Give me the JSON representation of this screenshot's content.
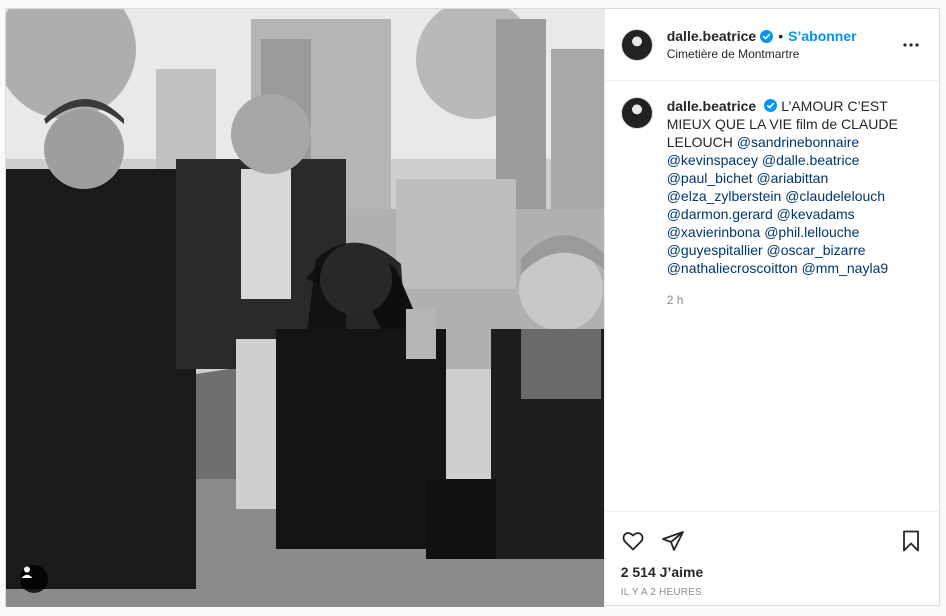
{
  "header": {
    "username": "dalle.beatrice",
    "separator": "•",
    "follow_label": "S’abonner",
    "location": "Cimetière de Montmartre"
  },
  "caption": {
    "username": "dalle.beatrice",
    "text": "L’AMOUR C’EST MIEUX QUE LA VIE film de CLAUDE LELOUCH",
    "mentions": [
      "@sandrinebonnaire",
      "@kevinspacey",
      "@dalle.beatrice",
      "@paul_bichet",
      "@ariabittan",
      "@elza_zylberstein",
      "@claudelelouch",
      "@darmon.gerard",
      "@kevadams",
      "@xavierinbona",
      "@phil.lellouche",
      "@guyespitallier",
      "@oscar_bizarre",
      "@nathaliecroscoitton",
      "@mm_nayla9"
    ],
    "time": "2 h"
  },
  "footer": {
    "likes": "2 514 J’aime",
    "posted_ago": "IL Y A 2 HEURES"
  },
  "icons": {
    "verified": "verified-badge-icon",
    "more": "more-options-icon",
    "like": "heart-icon",
    "share": "paper-plane-icon",
    "save": "bookmark-icon",
    "tags": "user-tag-icon"
  },
  "colors": {
    "link_blue": "#0095f6",
    "mention": "#00376b",
    "muted": "#8e8e8e",
    "border": "#dbdbdb"
  }
}
